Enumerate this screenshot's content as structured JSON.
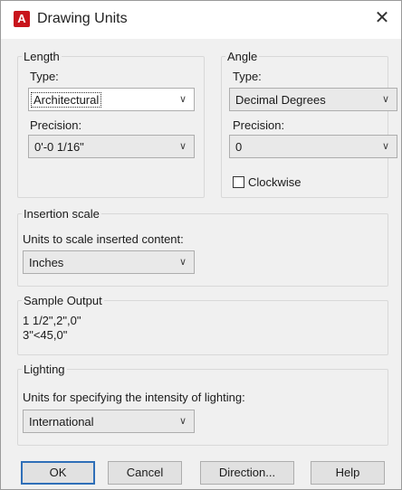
{
  "window": {
    "title": "Drawing Units",
    "icon": "autocad-icon"
  },
  "length": {
    "group_label": "Length",
    "type_label": "Type:",
    "type_value": "Architectural",
    "precision_label": "Precision:",
    "precision_value": "0'-0 1/16\""
  },
  "angle": {
    "group_label": "Angle",
    "type_label": "Type:",
    "type_value": "Decimal Degrees",
    "precision_label": "Precision:",
    "precision_value": "0",
    "clockwise_label": "Clockwise",
    "clockwise_checked": false
  },
  "insertion": {
    "group_label": "Insertion scale",
    "units_label": "Units to scale inserted content:",
    "units_value": "Inches"
  },
  "sample": {
    "group_label": "Sample Output",
    "line1": "1 1/2\",2\",0\"",
    "line2": "3\"<45,0\""
  },
  "lighting": {
    "group_label": "Lighting",
    "units_label": "Units for specifying the intensity of lighting:",
    "units_value": "International"
  },
  "buttons": {
    "ok": "OK",
    "cancel": "Cancel",
    "direction": "Direction...",
    "help": "Help"
  }
}
